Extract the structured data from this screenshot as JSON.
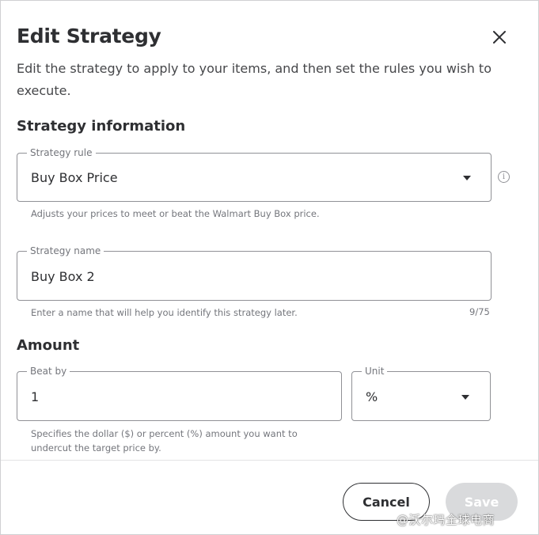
{
  "dialog": {
    "title": "Edit Strategy",
    "description": "Edit the strategy to apply to your items, and then set the rules you wish to execute."
  },
  "strategy_info": {
    "heading": "Strategy information",
    "rule": {
      "label": "Strategy rule",
      "value": "Buy Box Price",
      "helper": "Adjusts your prices to meet or beat the Walmart Buy Box price."
    },
    "name": {
      "label": "Strategy name",
      "value": "Buy Box 2",
      "helper": "Enter a name that will help you identify this strategy later.",
      "counter": "9/75"
    }
  },
  "amount": {
    "heading": "Amount",
    "beat_by": {
      "label": "Beat by",
      "value": "1"
    },
    "unit": {
      "label": "Unit",
      "value": "%"
    },
    "helper": "Specifies the dollar ($) or percent (%) amount you want to undercut the target price by."
  },
  "footer": {
    "cancel_label": "Cancel",
    "save_label": "Save"
  },
  "watermark": "@沃尔玛全球电商",
  "icons": {
    "close": "close-icon",
    "info": "info-icon",
    "dropdown": "caret-down-icon"
  },
  "colors": {
    "text": "#2e2f32",
    "muted": "#74767c",
    "border": "#909196",
    "disabled": "#d9dadc"
  }
}
